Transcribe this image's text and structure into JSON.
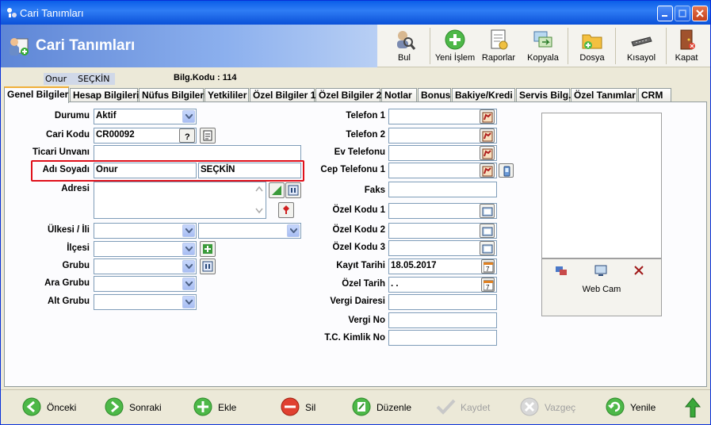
{
  "window": {
    "title": "Cari Tanımları"
  },
  "header": {
    "title": "Cari Tanımları"
  },
  "toolbar": {
    "items": [
      {
        "label": "Bul",
        "icon": "search-user-icon"
      },
      {
        "label": "Yeni İşlem",
        "icon": "add-icon"
      },
      {
        "label": "Raporlar",
        "icon": "report-icon"
      },
      {
        "label": "Kopyala",
        "icon": "copy-icon"
      },
      {
        "label": "Dosya",
        "icon": "folder-icon"
      },
      {
        "label": "Kısayol",
        "icon": "keyboard-icon"
      },
      {
        "label": "Kapat",
        "icon": "exit-door-icon"
      }
    ]
  },
  "info": {
    "first_name": "Onur",
    "last_name": "SEÇKİN",
    "code_label": "Bilg.Kodu : 114"
  },
  "tabs": [
    "Genel Bilgiler",
    "Hesap Bilgileri",
    "Nüfus Bilgileri",
    "Yetkililer",
    "Özel Bilgiler 1",
    "Özel Bilgiler 2",
    "Notlar",
    "Bonus",
    "Bakiye/Kredi",
    "Servis Bilg.",
    "Özel Tanımlar",
    "CRM"
  ],
  "form_left": {
    "durum_label": "Durumu",
    "durum_value": "Aktif",
    "cari_kodu_label": "Cari Kodu",
    "cari_kodu_value": "CR00092",
    "ticari_label": "Ticari Unvanı",
    "ticari_value": "",
    "adi_label": "Adı Soyadı",
    "adi_value": "Onur",
    "soyadi_value": "SEÇKİN",
    "adres_label": "Adresi",
    "adres_value": "",
    "ulke_label": "Ülkesi / İli",
    "ilce_label": "İlçesi",
    "grup_label": "Grubu",
    "ara_grup_label": "Ara Grubu",
    "alt_grup_label": "Alt Grubu"
  },
  "form_right": {
    "tel1_label": "Telefon 1",
    "tel2_label": "Telefon 2",
    "ev_label": "Ev Telefonu",
    "cep_label": "Cep Telefonu 1",
    "faks_label": "Faks",
    "ozel1_label": "Özel Kodu 1",
    "ozel2_label": "Özel Kodu 2",
    "ozel3_label": "Özel Kodu 3",
    "kayit_label": "Kayıt Tarihi",
    "kayit_value": "18.05.2017",
    "ozel_tarih_label": "Özel Tarih",
    "ozel_tarih_value": " . .",
    "vergi_dairesi_label": "Vergi Dairesi",
    "vergi_no_label": "Vergi No",
    "tc_label": "T.C. Kimlik No"
  },
  "photo": {
    "webcam_label": "Web Cam"
  },
  "bottom": {
    "items": [
      {
        "label": "Önceki",
        "enabled": true
      },
      {
        "label": "Sonraki",
        "enabled": true
      },
      {
        "label": "Ekle",
        "enabled": true
      },
      {
        "label": "Sil",
        "enabled": true
      },
      {
        "label": "Düzenle",
        "enabled": true
      },
      {
        "label": "Kaydet",
        "enabled": false
      },
      {
        "label": "Vazgeç",
        "enabled": false
      },
      {
        "label": "Yenile",
        "enabled": true
      }
    ]
  }
}
